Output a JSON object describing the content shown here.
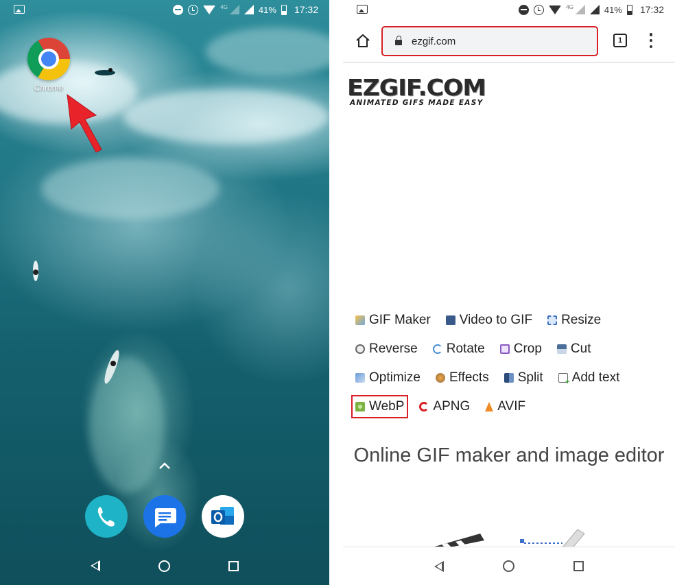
{
  "left_phone": {
    "status_bar": {
      "battery": "41%",
      "time": "17:32",
      "network": "4G"
    },
    "home_app": {
      "label": "Chrome",
      "icon": "chrome-icon"
    },
    "dock": [
      {
        "name": "phone-app",
        "icon": "phone-icon",
        "color": "#1eb3c6"
      },
      {
        "name": "messages-app",
        "icon": "message-icon",
        "color": "#1c73e8"
      },
      {
        "name": "outlook-app",
        "icon": "outlook-icon",
        "color": "#0f6cbd"
      }
    ]
  },
  "right_phone": {
    "status_bar": {
      "battery": "41%",
      "time": "17:32",
      "network": "4G"
    },
    "toolbar": {
      "url": "ezgif.com",
      "tab_count": "1"
    },
    "logo": {
      "main": "EZGIF.COM",
      "tagline": "ANIMATED GIFS MADE EASY"
    },
    "menu": {
      "rows": [
        [
          {
            "label": "GIF Maker",
            "icon": "gif-maker-icon"
          },
          {
            "label": "Video to GIF",
            "icon": "video-icon"
          },
          {
            "label": "Resize",
            "icon": "resize-icon"
          }
        ],
        [
          {
            "label": "Reverse",
            "icon": "reverse-icon"
          },
          {
            "label": "Rotate",
            "icon": "rotate-icon"
          },
          {
            "label": "Crop",
            "icon": "crop-icon"
          },
          {
            "label": "Cut",
            "icon": "cut-icon"
          }
        ],
        [
          {
            "label": "Optimize",
            "icon": "optimize-icon"
          },
          {
            "label": "Effects",
            "icon": "effects-icon"
          },
          {
            "label": "Split",
            "icon": "split-icon"
          },
          {
            "label": "Add text",
            "icon": "add-text-icon"
          }
        ],
        [
          {
            "label": "WebP",
            "icon": "webp-icon",
            "highlighted": true
          },
          {
            "label": "APNG",
            "icon": "apng-icon"
          },
          {
            "label": "AVIF",
            "icon": "avif-icon"
          }
        ]
      ]
    },
    "headline": "Online GIF maker and image editor"
  },
  "colors": {
    "highlight": "#d81f26",
    "arrow": "#e8232a"
  }
}
